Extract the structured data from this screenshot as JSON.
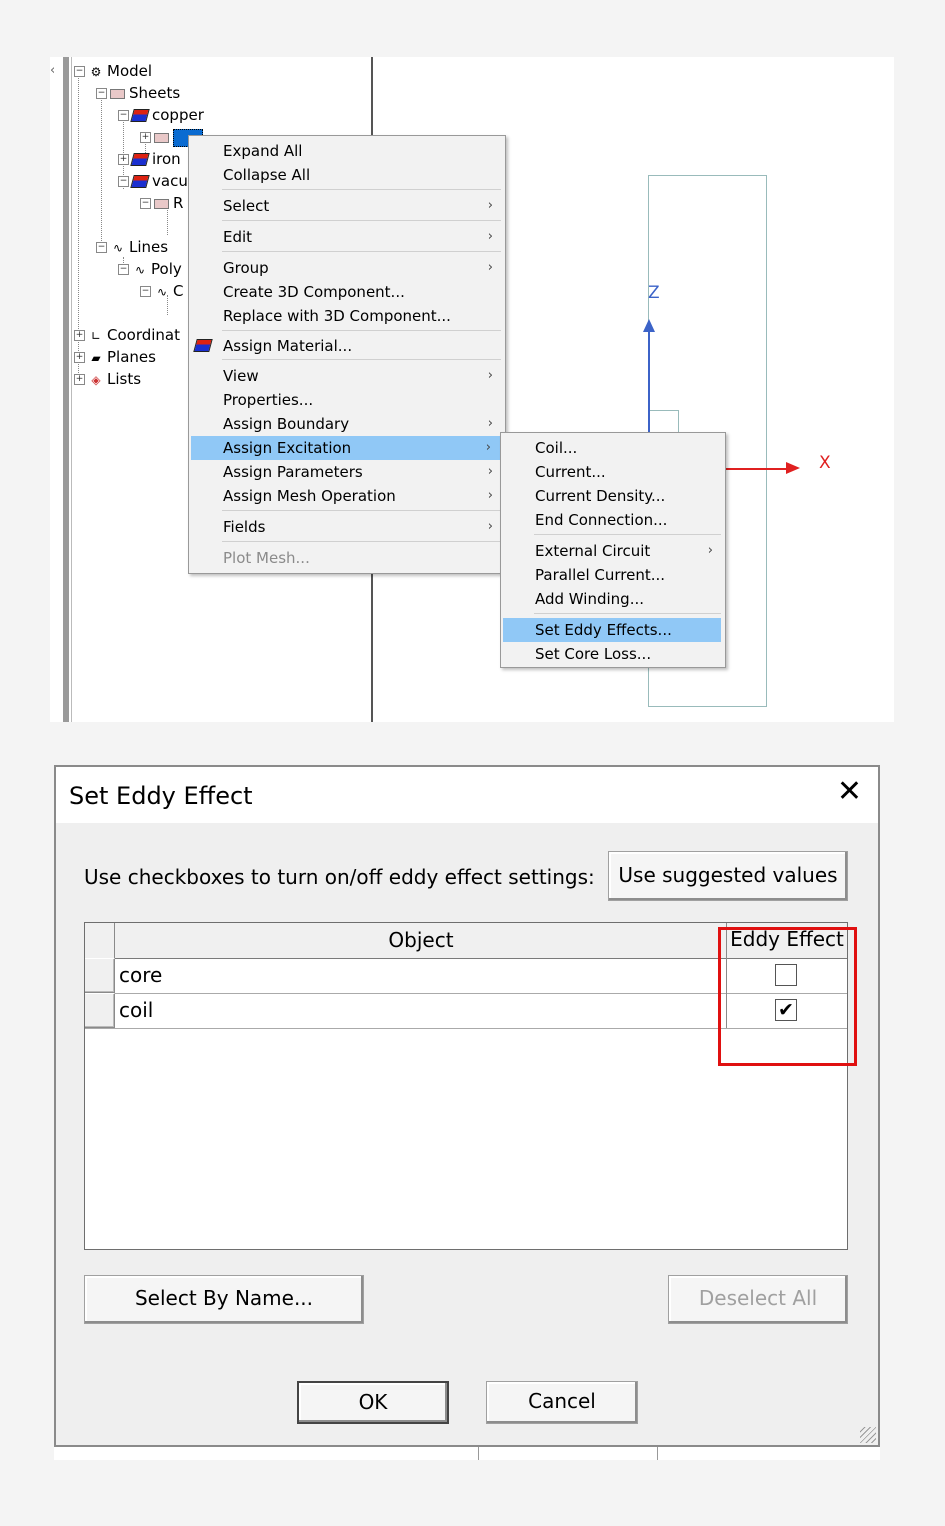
{
  "tree": {
    "model": "Model",
    "sheets": "Sheets",
    "copper": "copper",
    "iron": "iron",
    "vacuum": "vacu",
    "r_item": "R",
    "lines": "Lines",
    "poly": "Poly",
    "c_item": "C",
    "coordinates": "Coordinat",
    "planes": "Planes",
    "lists": "Lists"
  },
  "context_menu": {
    "items": [
      {
        "label": "Expand All"
      },
      {
        "label": "Collapse All"
      },
      {
        "label": "Select",
        "submenu": true
      },
      {
        "label": "Edit",
        "submenu": true
      },
      {
        "label": "Group",
        "submenu": true
      },
      {
        "label": "Create 3D Component..."
      },
      {
        "label": "Replace with 3D Component..."
      },
      {
        "label": "Assign Material..."
      },
      {
        "label": "View",
        "submenu": true
      },
      {
        "label": "Properties..."
      },
      {
        "label": "Assign Boundary",
        "submenu": true
      },
      {
        "label": "Assign Excitation",
        "submenu": true,
        "highlighted": true
      },
      {
        "label": "Assign Parameters",
        "submenu": true
      },
      {
        "label": "Assign Mesh Operation",
        "submenu": true
      },
      {
        "label": "Fields",
        "submenu": true
      },
      {
        "label": "Plot Mesh...",
        "disabled": true
      }
    ],
    "submenu_arrow": "›"
  },
  "excitation_submenu": {
    "items": [
      {
        "label": "Coil..."
      },
      {
        "label": "Current..."
      },
      {
        "label": "Current Density..."
      },
      {
        "label": "End Connection..."
      },
      {
        "label": "External Circuit",
        "submenu": true
      },
      {
        "label": "Parallel Current..."
      },
      {
        "label": "Add Winding..."
      },
      {
        "label": "Set Eddy Effects...",
        "highlighted": true
      },
      {
        "label": "Set Core Loss..."
      }
    ]
  },
  "view3d": {
    "axis_z_label": "Z",
    "axis_x_label": "X",
    "axis_z_color": "#3c63c8",
    "axis_x_color": "#e02020"
  },
  "dialog": {
    "title": "Set Eddy Effect",
    "close_glyph": "✕",
    "instruction": "Use checkboxes to turn on/off eddy effect settings:",
    "suggested_button": "Use suggested values",
    "columns": [
      "Object",
      "Eddy Effect"
    ],
    "rows": [
      {
        "object": "core",
        "eddy_effect": false
      },
      {
        "object": "coil",
        "eddy_effect": true
      }
    ],
    "check_glyph": "✔",
    "select_by_name_button": "Select By Name...",
    "deselect_all_button": "Deselect All",
    "ok_button": "OK",
    "cancel_button": "Cancel",
    "highlight_color": "#e01010"
  }
}
